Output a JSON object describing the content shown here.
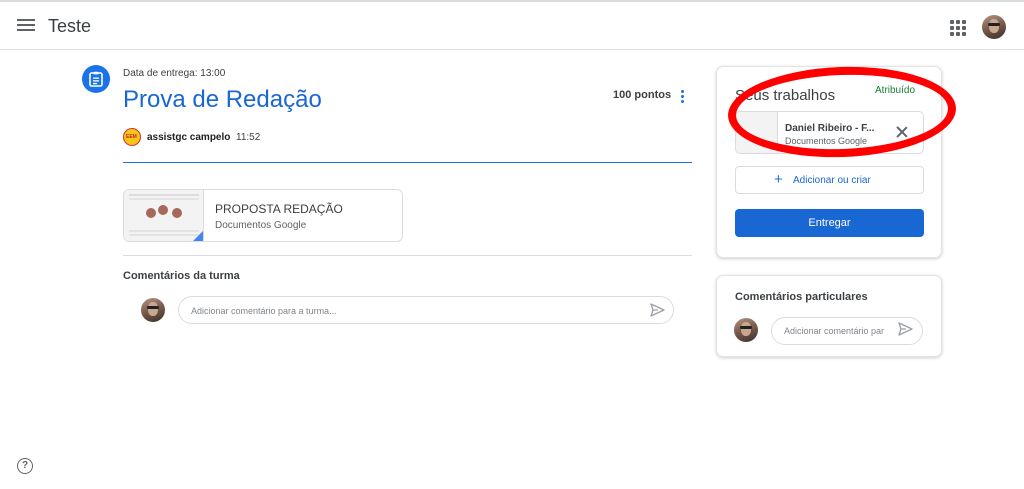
{
  "header": {
    "class_name": "Teste",
    "menu_icon": "menu-icon",
    "apps_icon": "apps-grid-icon",
    "account_icon": "account-avatar"
  },
  "assignment": {
    "due_label": "Data de entrega: 13:00",
    "title": "Prova de Redação",
    "points": "100 pontos",
    "author": "assistgc campelo",
    "author_logo_text": "EEM",
    "posted_time": "11:52",
    "attachment": {
      "title": "PROPOSTA REDAÇÃO",
      "type": "Documentos Google"
    },
    "class_comments_label": "Comentários da turma",
    "class_comment_placeholder": "Adicionar comentário para a turma..."
  },
  "your_work": {
    "title": "Seus trabalhos",
    "status": "Atribuído",
    "status_color": "#188038",
    "file": {
      "name": "Daniel Ribeiro - F...",
      "type": "Documentos Google"
    },
    "add_label": "Adicionar ou criar",
    "submit_label": "Entregar",
    "highlight_color": "#ff0000"
  },
  "private_comments": {
    "title": "Comentários particulares",
    "placeholder": "Adicionar comentário par"
  },
  "footer": {
    "help_symbol": "?"
  }
}
